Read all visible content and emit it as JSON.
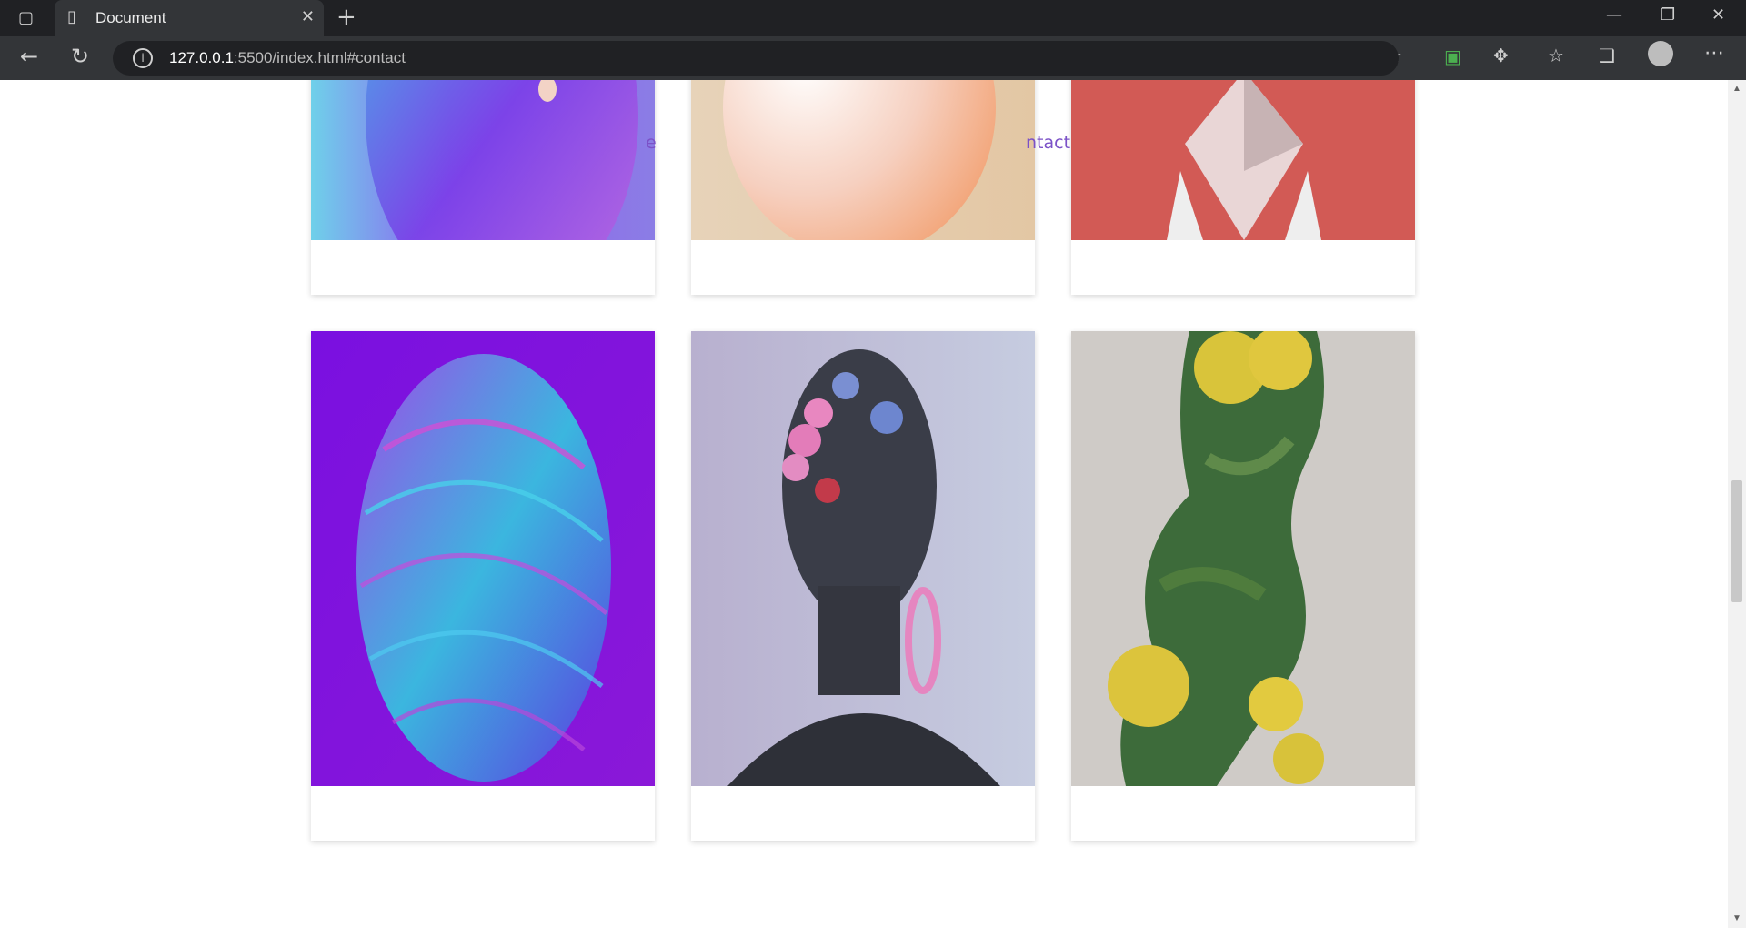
{
  "browser": {
    "tab_title": "Document",
    "url_host": "127.0.0.1",
    "url_rest": ":5500/index.html#contact",
    "icons": {
      "sidebar": "sidebar-icon",
      "page": "document-icon",
      "close": "close-icon",
      "new_tab": "plus-icon",
      "minimize": "minimize-icon",
      "restore": "restore-icon",
      "close_window": "close-icon",
      "back": "back-arrow-icon",
      "reload": "reload-icon",
      "info": "info-icon",
      "read_aloud": "read-aloud-icon",
      "favorite_add": "favorite-add-icon",
      "collections": "collections-icon",
      "extensions": "extensions-icon",
      "favorites": "favorites-icon",
      "tabs_stack": "tabs-stack-icon",
      "profile": "profile-icon",
      "more": "more-icon"
    }
  },
  "page": {
    "nav_left_fragment": "e",
    "nav_right_fragment": "ntact"
  },
  "cards": {
    "row1": [
      {
        "art": "Abstract blue and purple sphere"
      },
      {
        "art": "Peach gradient egg"
      },
      {
        "art": "White geometric shape on red"
      }
    ],
    "row2": [
      {
        "art": "Blue-purple swirl head"
      },
      {
        "art": "Dark metallic figure with pink beads"
      },
      {
        "art": "Yellow roses silhouette"
      }
    ]
  },
  "colors": {
    "nav_link": "#7b51c7",
    "chrome_dark": "#202124",
    "chrome_toolbar": "#333538"
  }
}
